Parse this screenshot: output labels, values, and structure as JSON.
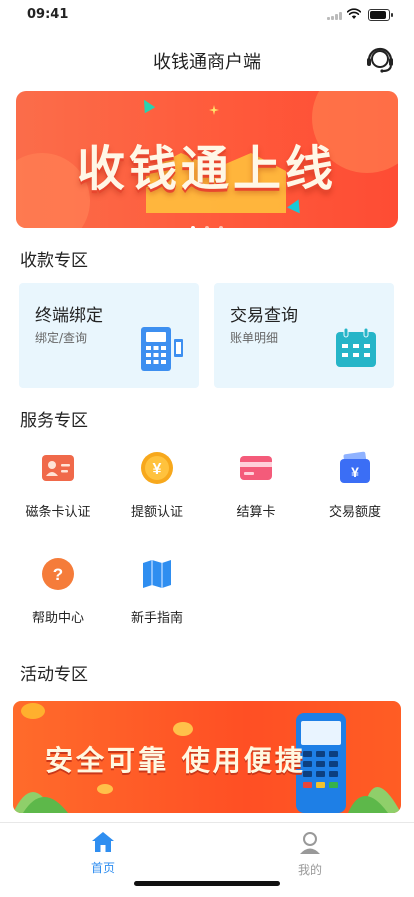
{
  "status": {
    "time": "09:41"
  },
  "nav": {
    "title": "收钱通商户端",
    "icon": "customer-service-headset-icon"
  },
  "banner": {
    "text": "收钱通上线",
    "slide_count": 3,
    "active_slide": 1
  },
  "sections": {
    "collect": "收款专区",
    "service": "服务专区",
    "activity": "活动专区"
  },
  "cards": [
    {
      "title": "终端绑定",
      "subtitle": "绑定/查询",
      "icon": "pos-terminal-icon"
    },
    {
      "title": "交易查询",
      "subtitle": "账单明细",
      "icon": "calendar-icon"
    }
  ],
  "services": [
    {
      "label": "磁条卡认证",
      "icon": "id-card-icon",
      "color": "#f0694a"
    },
    {
      "label": "提额认证",
      "icon": "yen-coin-icon",
      "color": "#f7a81c"
    },
    {
      "label": "结算卡",
      "icon": "bank-card-icon",
      "color": "#f45b7a"
    },
    {
      "label": "交易额度",
      "icon": "wallet-yen-icon",
      "color": "#3b6ef5"
    },
    {
      "label": "帮助中心",
      "icon": "question-icon",
      "color": "#f57c3a"
    },
    {
      "label": "新手指南",
      "icon": "map-guide-icon",
      "color": "#2f8ef0"
    }
  ],
  "promo": {
    "text": "安全可靠  使用便捷"
  },
  "tabs": [
    {
      "label": "首页",
      "icon": "home-icon",
      "active": true,
      "color": "#2f8ef0"
    },
    {
      "label": "我的",
      "icon": "user-icon",
      "active": false,
      "color": "#999999"
    }
  ]
}
